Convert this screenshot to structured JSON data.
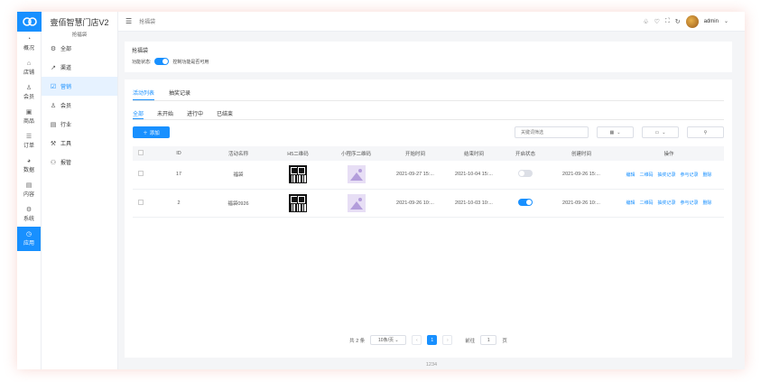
{
  "app": {
    "store_name": "壹佰智慧门店V2",
    "store_sub": "抢福袋",
    "breadcrumb": "抢福袋",
    "user": "admin",
    "footer": "1234"
  },
  "rail": [
    {
      "label": "概况",
      "icon": "dashboard-icon",
      "glyph": "◔"
    },
    {
      "label": "店铺",
      "icon": "store-icon",
      "glyph": "⌂"
    },
    {
      "label": "会员",
      "icon": "member-icon",
      "glyph": "♙"
    },
    {
      "label": "商品",
      "icon": "goods-icon",
      "glyph": "▣"
    },
    {
      "label": "订单",
      "icon": "order-icon",
      "glyph": "☰"
    },
    {
      "label": "数据",
      "icon": "data-icon",
      "glyph": "◕"
    },
    {
      "label": "内容",
      "icon": "content-icon",
      "glyph": "▤"
    },
    {
      "label": "系统",
      "icon": "system-icon",
      "glyph": "⚙"
    },
    {
      "label": "应用",
      "icon": "app-icon",
      "glyph": "◷",
      "active": true
    }
  ],
  "sidebar": [
    {
      "label": "全部",
      "icon": "all-icon",
      "glyph": "⚙"
    },
    {
      "label": "渠道",
      "icon": "channel-icon",
      "glyph": "↗"
    },
    {
      "label": "营销",
      "icon": "marketing-icon",
      "glyph": "☑",
      "active": true
    },
    {
      "label": "会员",
      "icon": "member-icon",
      "glyph": "♙"
    },
    {
      "label": "行业",
      "icon": "industry-icon",
      "glyph": "▤"
    },
    {
      "label": "工具",
      "icon": "tool-icon",
      "glyph": "⚒"
    },
    {
      "label": "报管",
      "icon": "report-icon",
      "glyph": "⚇"
    }
  ],
  "settings": {
    "title": "抢福袋",
    "status_label": "功能状态:",
    "status_hint": "控制功能是否可用"
  },
  "tabs": [
    "活动列表",
    "抽奖记录"
  ],
  "subtabs": [
    "全部",
    "未开始",
    "进行中",
    "已结束"
  ],
  "toolbar": {
    "add_label": "添加",
    "search_placeholder": "关键词筛选"
  },
  "table": {
    "headers": [
      "ID",
      "活动名称",
      "H5二维码",
      "小程序二维码",
      "开始时间",
      "结束时间",
      "开启状态",
      "创建时间",
      "操作"
    ],
    "rows": [
      {
        "id": "17",
        "name": "福袋",
        "start": "2021-09-27 15:...",
        "end": "2021-10-04 15:...",
        "enabled": false,
        "created": "2021-09-26 15:..."
      },
      {
        "id": "2",
        "name": "福袋0926",
        "start": "2021-09-26 10:...",
        "end": "2021-10-03 10:...",
        "enabled": true,
        "created": "2021-09-26 10:..."
      }
    ],
    "ops": [
      "编辑",
      "二维码",
      "抽奖记录",
      "参与记录",
      "删除"
    ]
  },
  "pager": {
    "total": "共 2 条",
    "page_size": "10条/页",
    "current": "1",
    "goto_prefix": "前往",
    "goto_value": "1",
    "goto_suffix": "页"
  }
}
